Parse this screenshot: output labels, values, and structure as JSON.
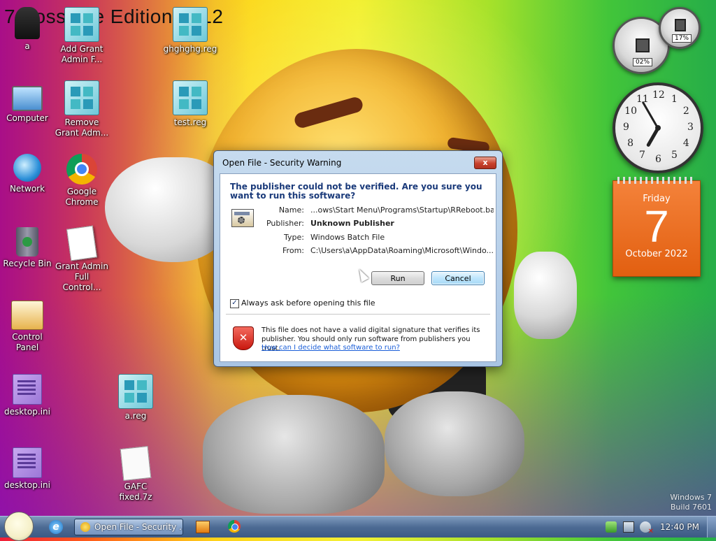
{
  "wallpaper_title": "7 Bossk   ae Edition 2012",
  "desktop_icons": [
    {
      "label": "a"
    },
    {
      "label": "Add Grant Admin F..."
    },
    {
      "label": "ghghghg.reg"
    },
    {
      "label": "Computer"
    },
    {
      "label": "Remove Grant Adm..."
    },
    {
      "label": "test.reg"
    },
    {
      "label": "Network"
    },
    {
      "label": "Google Chrome"
    },
    {
      "label": "Recycle Bin"
    },
    {
      "label": "Grant Admin Full Control..."
    },
    {
      "label": "Control Panel"
    },
    {
      "label": "desktop.ini"
    },
    {
      "label": "a.reg"
    },
    {
      "label": "desktop.ini"
    },
    {
      "label": "GAFC fixed.7z"
    }
  ],
  "gadgets": {
    "cpu_meter": {
      "cpu": "02%",
      "memory": "17%"
    },
    "clock": {
      "numerals": [
        "12",
        "1",
        "2",
        "3",
        "4",
        "5",
        "6",
        "7",
        "8",
        "9",
        "10",
        "11"
      ],
      "hour_hand_deg": 30,
      "minute_hand_deg": -30
    },
    "calendar": {
      "weekday": "Friday",
      "day": "7",
      "month_year": "October 2022"
    }
  },
  "dialog": {
    "title": "Open File - Security Warning",
    "close": "x",
    "heading": "The publisher could not be verified.  Are you sure you want to run this software?",
    "fields": [
      {
        "key": "Name:",
        "value": "...ows\\Start Menu\\Programs\\Startup\\RReboot.bat",
        "bold": false
      },
      {
        "key": "Publisher:",
        "value": "Unknown Publisher",
        "bold": true
      },
      {
        "key": "Type:",
        "value": "Windows Batch File",
        "bold": false
      },
      {
        "key": "From:",
        "value": "C:\\Users\\a\\AppData\\Roaming\\Microsoft\\Windo...",
        "bold": false
      }
    ],
    "run_label": "Run",
    "cancel_label": "Cancel",
    "checkbox_label": "Always ask before opening this file",
    "checkbox_checked": true,
    "warning_text": "This file does not have a valid digital signature that verifies its publisher.  You should only run software from publishers you trust.",
    "help_link": "How can I decide what software to run?"
  },
  "taskbar": {
    "ie_glyph": "e",
    "active_task": "Open File - Security ...",
    "time": "12:40 PM"
  },
  "version_watermark": {
    "line1": "Windows 7",
    "line2": "Build 7601"
  }
}
